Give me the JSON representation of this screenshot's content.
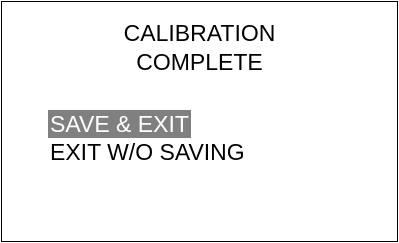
{
  "screen": {
    "title_line_1": "CALIBRATION",
    "title_line_2": "COMPLETE"
  },
  "menu": {
    "items": [
      {
        "label": "SAVE & EXIT",
        "selected": true
      },
      {
        "label": "EXIT W/O SAVING",
        "selected": false
      }
    ],
    "highlight_color": "#808080",
    "highlight_text_color": "#ffffff"
  }
}
